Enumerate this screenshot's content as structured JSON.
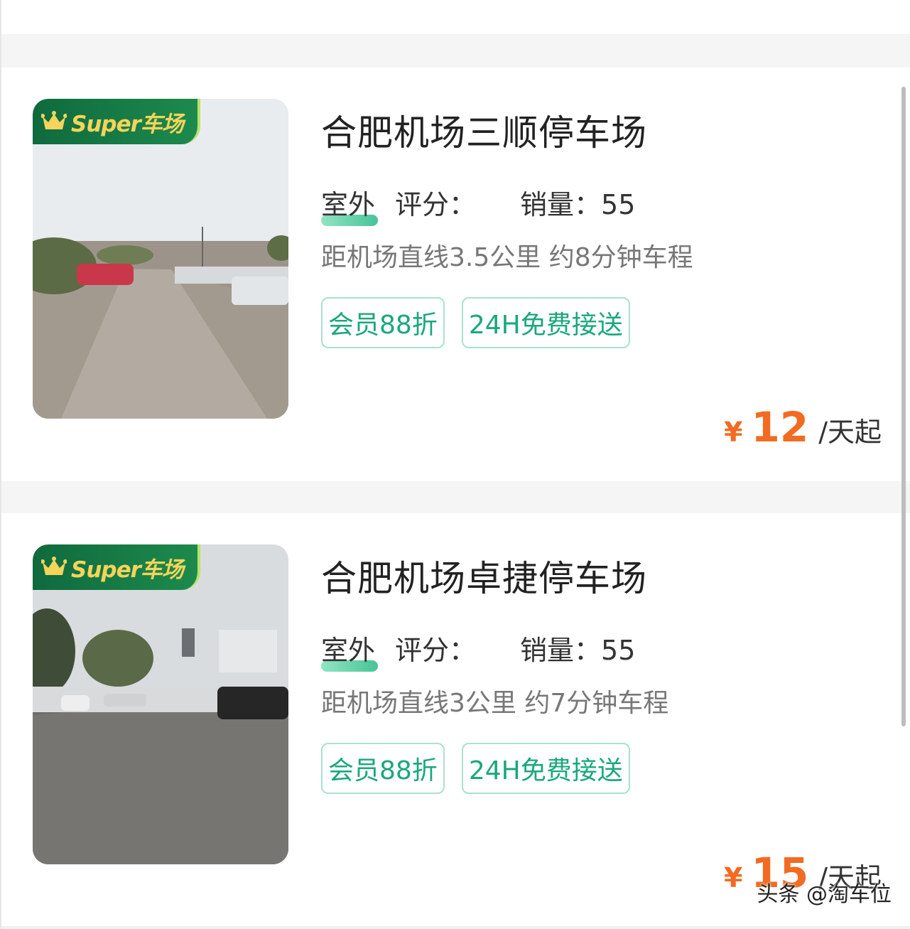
{
  "listings": [
    {
      "badge": "Super车场",
      "title": "合肥机场三顺停车场",
      "type": "室外",
      "score_label": "评分：",
      "sales_label": "销量：55",
      "distance": "距机场直线3.5公里 约8分钟车程",
      "tags": [
        "会员88折",
        "24H免费接送"
      ],
      "price_symbol": "¥",
      "price": "12",
      "price_unit": "/天起"
    },
    {
      "badge": "Super车场",
      "title": "合肥机场卓捷停车场",
      "type": "室外",
      "score_label": "评分：",
      "sales_label": "销量：55",
      "distance": "距机场直线3公里 约7分钟车程",
      "tags": [
        "会员88折",
        "24H免费接送"
      ],
      "price_symbol": "¥",
      "price": "15",
      "price_unit": "/天起"
    }
  ],
  "watermark": "头条 @淘车位",
  "colors": {
    "accent_green": "#1aa87a",
    "price_orange": "#f26b22",
    "badge_green": "#0f6a3e"
  }
}
